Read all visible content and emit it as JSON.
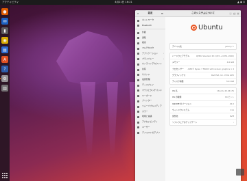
{
  "topbar": {
    "activities": "アクティビティ",
    "clock": "4月21日 16:21",
    "status_icons": "▲ ◉ ⏻"
  },
  "dock": {
    "items": [
      {
        "name": "firefox-icon",
        "color": "#e66000",
        "glyph": "●"
      },
      {
        "name": "thunderbird-icon",
        "color": "#1a66c9",
        "glyph": "✉"
      },
      {
        "name": "files-icon",
        "color": "#5f5f5f",
        "glyph": "▮"
      },
      {
        "name": "rhythmbox-icon",
        "color": "#e0b400",
        "glyph": "◉"
      },
      {
        "name": "writer-icon",
        "color": "#2a6fd6",
        "glyph": "▤"
      },
      {
        "name": "app-center-icon",
        "color": "#e95420",
        "glyph": "A"
      },
      {
        "name": "help-icon",
        "color": "#2b5fae",
        "glyph": "?"
      },
      {
        "name": "settings-icon",
        "color": "#9a9a9a",
        "glyph": "⚙"
      },
      {
        "name": "trash-icon",
        "color": "#777777",
        "glyph": "▥"
      }
    ]
  },
  "settings": {
    "sidebar_title": "設定",
    "window_title": "このシステムについて",
    "sidebar_items": [
      {
        "label": "ネットワーク",
        "chevron": false
      },
      {
        "label": "Bluetooth",
        "chevron": false
      },
      {
        "label": "",
        "chevron": false,
        "separator": true
      },
      {
        "label": "外観",
        "chevron": false
      },
      {
        "label": "通知",
        "chevron": false
      },
      {
        "label": "検索",
        "chevron": false
      },
      {
        "label": "マルチタスク",
        "chevron": false
      },
      {
        "label": "アプリケーション",
        "chevron": true
      },
      {
        "label": "プライバシー",
        "chevron": true
      },
      {
        "label": "オンラインアカウント",
        "chevron": false
      },
      {
        "label": "共有",
        "chevron": false
      },
      {
        "label": "サウンド",
        "chevron": false
      },
      {
        "label": "電源管理",
        "chevron": false
      },
      {
        "label": "ディスプレイ",
        "chevron": false
      },
      {
        "label": "マウスとタッチパッド",
        "chevron": false
      },
      {
        "label": "キーボード",
        "chevron": false
      },
      {
        "label": "プリンター",
        "chevron": false
      },
      {
        "label": "リムーバブルメディア",
        "chevron": false
      },
      {
        "label": "カラー",
        "chevron": false
      },
      {
        "label": "地域と言語",
        "chevron": false
      },
      {
        "label": "アクセシビリティ",
        "chevron": false
      },
      {
        "label": "ユーザー",
        "chevron": false
      },
      {
        "label": "デフォルトのアプリ",
        "chevron": false
      }
    ],
    "logo_text": "Ubuntu",
    "device_card": [
      {
        "key": "デバイス名",
        "value": "jammy ✎"
      }
    ],
    "hw_card": [
      {
        "key": "ハードウェアモデル",
        "value": "QEMU Standard PC (Q35 + ICH9, 2009)"
      },
      {
        "key": "メモリー",
        "value": "4.0 GiB"
      },
      {
        "key": "プロセッサー",
        "value": "AMD® Ryzen 7 5800h with radeon graphics × 4"
      },
      {
        "key": "グラフィックス",
        "value": "Red Hat, Inc. Virtio GPU"
      },
      {
        "key": "ディスク容量",
        "value": "34.4 GB"
      }
    ],
    "os_card": [
      {
        "key": "OS 名",
        "value": "Ubuntu 22.04 LTS"
      },
      {
        "key": "OS の種類",
        "value": "64 ビット"
      },
      {
        "key": "GNOME のバージョン",
        "value": "42.0"
      },
      {
        "key": "ウィンドウシステム",
        "value": "X11"
      },
      {
        "key": "仮想化",
        "value": "KVM"
      },
      {
        "key": "ソフトウェアのアップデート",
        "value": "›"
      }
    ]
  }
}
